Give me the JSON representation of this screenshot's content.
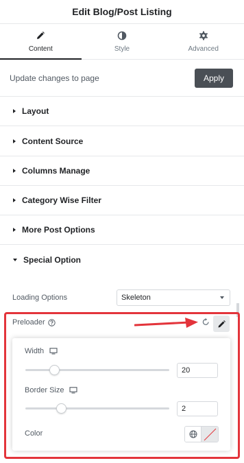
{
  "header": {
    "title": "Edit Blog/Post Listing"
  },
  "tabs": [
    {
      "label": "Content",
      "icon": "pencil-icon",
      "active": true
    },
    {
      "label": "Style",
      "icon": "half-circle-icon",
      "active": false
    },
    {
      "label": "Advanced",
      "icon": "gear-icon",
      "active": false
    }
  ],
  "update_bar": {
    "text": "Update changes to page",
    "button_label": "Apply"
  },
  "sections": [
    {
      "label": "Layout",
      "open": false
    },
    {
      "label": "Content Source",
      "open": false
    },
    {
      "label": "Columns Manage",
      "open": false
    },
    {
      "label": "Category Wise Filter",
      "open": false
    },
    {
      "label": "More Post Options",
      "open": false
    },
    {
      "label": "Special Option",
      "open": true
    }
  ],
  "special_option": {
    "loading_options": {
      "label": "Loading Options",
      "value": "Skeleton"
    },
    "preloader": {
      "label": "Preloader"
    }
  },
  "popover": {
    "width": {
      "label": "Width",
      "value": "20",
      "slider_fraction": 0.2
    },
    "border_size": {
      "label": "Border Size",
      "value": "2",
      "slider_fraction": 0.25
    },
    "color": {
      "label": "Color"
    }
  },
  "colors": {
    "accent_red": "#e3343b",
    "button_dark": "#4a4f55",
    "text_dark": "#1f2124",
    "text_muted": "#515962",
    "border": "#d5d8dc"
  }
}
